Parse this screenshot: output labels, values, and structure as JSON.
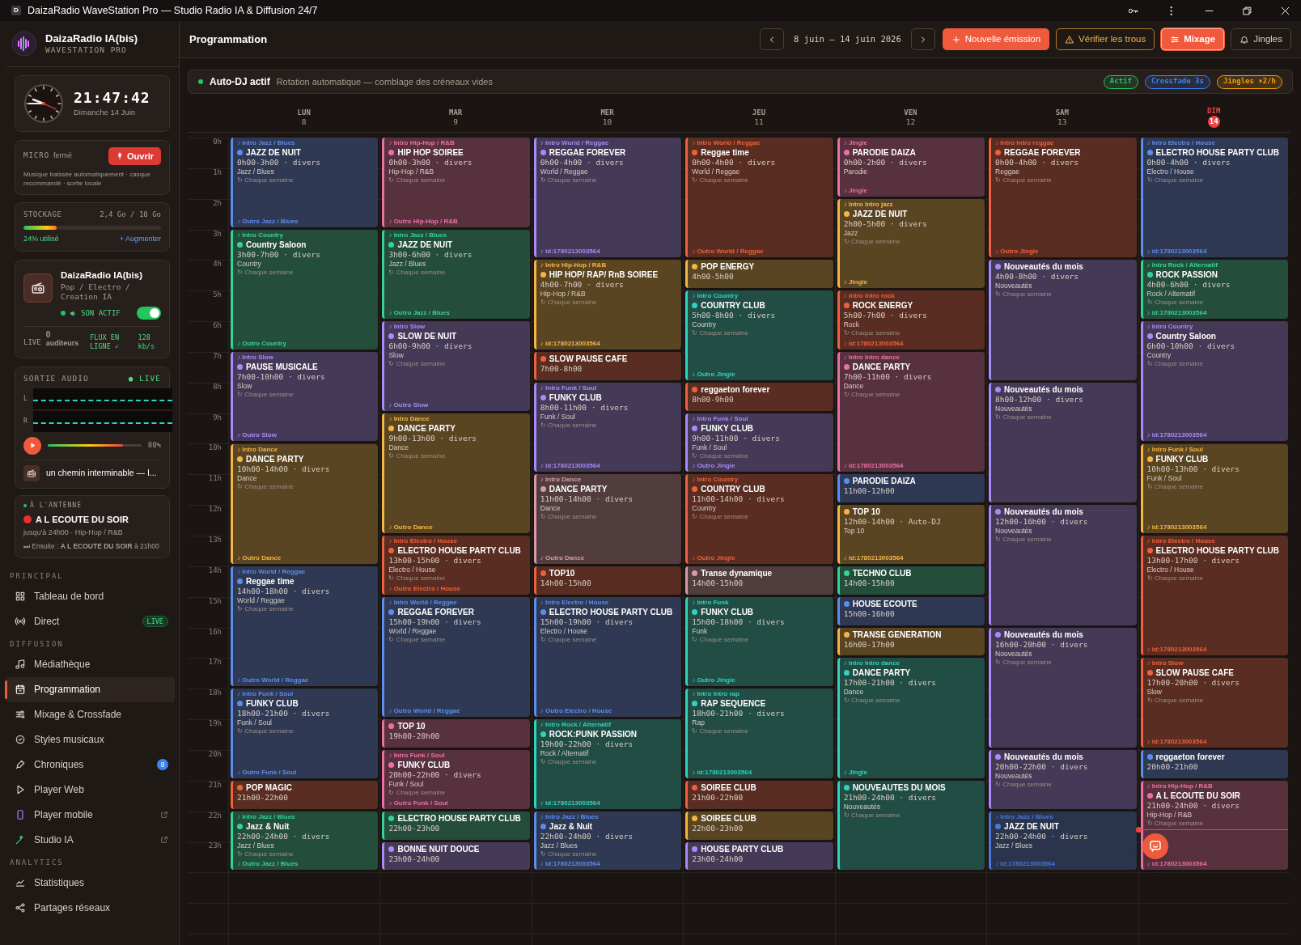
{
  "window": {
    "icon_letter": "D",
    "title": "DaizaRadio WaveStation Pro — Studio Radio IA & Diffusion 24/7"
  },
  "brand": {
    "name": "DaizaRadio IA(bis)",
    "subtitle": "WAVESTATION PRO"
  },
  "clock": {
    "time": "21:47:42",
    "date": "Dimanche 14 Juin"
  },
  "micro": {
    "label": "MICRO",
    "state": "fermé",
    "button": "Ouvrir",
    "note": "Musique baissée automatiquement · casque recommandé · sortie locale"
  },
  "storage": {
    "label": "STOCKAGE",
    "value": "2,4 Go / 10 Go",
    "level": 0.24,
    "used": "24% utilisé",
    "action": "+ Augmenter"
  },
  "station": {
    "name": "DaizaRadio IA(bis)",
    "genres": "Pop / Electro / Creation IA",
    "sound_label": "SON ACTIF",
    "on": true,
    "live": "LIVE",
    "listeners": "0",
    "listeners_label": "auditeurs",
    "stream": "FLUX EN LIGNE ✓",
    "bitrate": "128 kb/s"
  },
  "audio_out": {
    "title": "SORTIE AUDIO",
    "live": "● LIVE",
    "channels": [
      {
        "label": "L"
      },
      {
        "label": "R"
      }
    ],
    "volume": {
      "level": 0.8,
      "reading": "80%"
    },
    "track": "un chemin interminable — I..."
  },
  "on_air": {
    "label": "À L'ANTENNE",
    "title": "A L ECOUTE DU SOIR",
    "detail": "jusqu'à 24h00 · Hip-Hop / R&B",
    "next": "⏭ Ensuite : **A L ECOUTE DU SOIR** à 21h00"
  },
  "nav": [
    {
      "section": "PRINCIPAL",
      "items": [
        {
          "label": "Tableau de bord",
          "selected": false,
          "external": false
        },
        {
          "label": "Direct",
          "selected": false,
          "external": false,
          "badge": {
            "kind": "status",
            "text": "LIVE"
          }
        }
      ]
    },
    {
      "section": "DIFFUSION",
      "items": [
        {
          "label": "Médiathèque",
          "selected": false,
          "external": false
        },
        {
          "label": "Programmation",
          "selected": true,
          "external": false
        },
        {
          "label": "Mixage & Crossfade",
          "selected": false,
          "external": false
        },
        {
          "label": "Styles musicaux",
          "selected": false,
          "external": false
        },
        {
          "label": "Chroniques",
          "selected": false,
          "external": false,
          "badge": {
            "kind": "count",
            "text": "8"
          }
        },
        {
          "label": "Player Web",
          "selected": false,
          "external": false
        },
        {
          "label": "Player mobile",
          "selected": false,
          "external": true
        },
        {
          "label": "Studio IA",
          "selected": false,
          "external": true
        }
      ]
    },
    {
      "section": "ANALYTICS",
      "items": [
        {
          "label": "Statistiques",
          "selected": false,
          "external": false
        },
        {
          "label": "Partages réseaux",
          "selected": false,
          "external": false
        }
      ]
    }
  ],
  "header": {
    "title": "Programmation",
    "range": "8 juin — 14 juin 2026",
    "actions": [
      {
        "label": "Nouvelle émission",
        "kind": "primary"
      },
      {
        "label": "Vérifier les trous",
        "kind": "warning"
      },
      {
        "label": "Mixage",
        "kind": "toggle",
        "selected": true
      },
      {
        "label": "Jingles",
        "kind": "toggle",
        "selected": false
      }
    ]
  },
  "autodj": {
    "title": "Auto-DJ actif",
    "on": true,
    "description": "Rotation automatique — comblage des créneaux vides",
    "tags": [
      {
        "text": "Actif",
        "color": "#22c55e"
      },
      {
        "text": "Crossfade 3s",
        "color": "#3b82f6"
      },
      {
        "text": "Jingles ×2/h",
        "color": "#f59e0b"
      }
    ]
  },
  "calendar": {
    "hours": [
      "0h",
      "1h",
      "2h",
      "3h",
      "4h",
      "5h",
      "6h",
      "7h",
      "8h",
      "9h",
      "10h",
      "11h",
      "12h",
      "13h",
      "14h",
      "15h",
      "16h",
      "17h",
      "18h",
      "19h",
      "20h",
      "21h",
      "22h",
      "23h"
    ],
    "days": [
      {
        "name": "LUN",
        "date": "8",
        "today": false,
        "events": [
          {
            "color": "#5b8def",
            "intro": "♪ Intro Jazz / Blues",
            "title": "JAZZ DE NUIT",
            "time": "0h00-3h00 · divers",
            "style": "Jazz / Blues",
            "recur": "↻ Chaque semaine",
            "outro": "♪ Outro Jazz / Blues"
          },
          {
            "color": "#34d399",
            "intro": "♪ Intro Country",
            "title": "Country Saloon",
            "time": "3h00-7h00 · divers",
            "style": "Country",
            "recur": "↻ Chaque semaine",
            "outro": "♪ Outro Country"
          },
          {
            "color": "#a78bfa",
            "intro": "♪ Intro Slow",
            "title": "PAUSE MUSICALE",
            "time": "7h00-10h00 · divers",
            "style": "Slow",
            "recur": "↻ Chaque semaine",
            "outro": "♪ Outro Slow"
          },
          {
            "color": "#f5b544",
            "intro": "♪ Intro Dance",
            "title": "DANCE PARTY",
            "time": "10h00-14h00 · divers",
            "style": "Dance",
            "recur": "↻ Chaque semaine",
            "outro": "♪ Outro Dance"
          },
          {
            "color": "#5b8def",
            "intro": "♪ Intro World / Reggae",
            "title": "Reggae time",
            "time": "14h00-18h00 · divers",
            "style": "World / Reggae",
            "recur": "↻ Chaque semaine",
            "outro": "♪ Outro World / Reggae"
          },
          {
            "color": "#5b8def",
            "intro": "♪ Intro Funk / Soul",
            "title": "FUNKY CLUB",
            "time": "18h00-21h00 · divers",
            "style": "Funk / Soul",
            "recur": "↻ Chaque semaine",
            "outro": "♪ Outro Funk / Soul"
          },
          {
            "color": "#f0603c",
            "title": "POP MAGIC",
            "time": "21h00-22h00"
          },
          {
            "color": "#34d399",
            "intro": "♪ Intro Jazz / Blues",
            "title": "Jazz & Nuit",
            "time": "22h00-24h00 · divers",
            "style": "Jazz / Blues",
            "recur": "↻ Chaque semaine",
            "outro": "♪ Outro Jazz / Blues"
          }
        ]
      },
      {
        "name": "MAR",
        "date": "9",
        "today": false,
        "events": [
          {
            "color": "#ec6fa7",
            "intro": "♪ Intro Hip-Hop / R&B",
            "title": "HIP HOP SOIREE",
            "time": "0h00-3h00 · divers",
            "style": "Hip-Hop / R&B",
            "recur": "↻ Chaque semaine",
            "outro": "♪ Outro Hip-Hop / R&B"
          },
          {
            "color": "#34d399",
            "intro": "♪ Intro Jazz / Blues",
            "title": "JAZZ DE NUIT",
            "time": "3h00-6h00 · divers",
            "style": "Jazz / Blues",
            "recur": "↻ Chaque semaine",
            "outro": "♪ Outro Jazz / Blues"
          },
          {
            "color": "#a78bfa",
            "intro": "♪ Intro Slow",
            "title": "SLOW DE NUIT",
            "time": "6h00-9h00 · divers",
            "style": "Slow",
            "recur": "↻ Chaque semaine",
            "outro": "♪ Outro Slow"
          },
          {
            "color": "#f5b544",
            "intro": "♪ Intro Dance",
            "title": "DANCE PARTY",
            "time": "9h00-13h00 · divers",
            "style": "Dance",
            "recur": "↻ Chaque semaine",
            "outro": "♪ Outro Dance"
          },
          {
            "color": "#f0603c",
            "intro": "♪ Intro Electro / House",
            "title": "ELECTRO HOUSE PARTY CLUB",
            "time": "13h00-15h00 · divers",
            "style": "Electro / House",
            "recur": "↻ Chaque semaine",
            "outro": "♪ Outro Electro / House"
          },
          {
            "color": "#5b8def",
            "intro": "♪ Intro World / Reggae",
            "title": "REGGAE FOREVER",
            "time": "15h00-19h00 · divers",
            "style": "World / Reggae",
            "recur": "↻ Chaque semaine",
            "outro": "♪ Outro World / Reggae"
          },
          {
            "color": "#ec6fa7",
            "title": "TOP 10",
            "time": "19h00-20h00"
          },
          {
            "color": "#ec6fa7",
            "intro": "♪ Intro Funk / Soul",
            "title": "FUNKY CLUB",
            "time": "20h00-22h00 · divers",
            "style": "Funk / Soul",
            "recur": "↻ Chaque semaine",
            "outro": "♪ Outro Funk / Soul"
          },
          {
            "color": "#34d399",
            "title": "ELECTRO HOUSE PARTY CLUB",
            "time": "22h00-23h00"
          },
          {
            "color": "#a78bfa",
            "title": "BONNE NUIT DOUCE",
            "time": "23h00-24h00"
          }
        ]
      },
      {
        "name": "MER",
        "date": "10",
        "today": false,
        "events": [
          {
            "color": "#a78bfa",
            "intro": "♪ Intro World / Reggae",
            "title": "REGGAE FOREVER",
            "time": "0h00-4h00 · divers",
            "style": "World / Reggae",
            "recur": "↻ Chaque semaine",
            "outro": "♪ id:1780213003564"
          },
          {
            "color": "#f5b544",
            "intro": "♪ Intro Hip-Hop / R&B",
            "title": "HIP HOP/ RAP/ RnB SOIREE",
            "time": "4h00-7h00 · divers",
            "style": "Hip-Hop / R&B",
            "recur": "↻ Chaque semaine",
            "outro": "♪ id:1780213003564"
          },
          {
            "color": "#f0603c",
            "title": "SLOW PAUSE CAFE",
            "time": "7h00-8h00"
          },
          {
            "color": "#a78bfa",
            "intro": "♪ Intro Funk / Soul",
            "title": "FUNKY CLUB",
            "time": "8h00-11h00 · divers",
            "style": "Funk / Soul",
            "recur": "↻ Chaque semaine",
            "outro": "♪ id:1780213003564"
          },
          {
            "color": "#d99aa6",
            "intro": "♪ Intro Dance",
            "title": "DANCE PARTY",
            "time": "11h00-14h00 · divers",
            "style": "Dance",
            "recur": "↻ Chaque semaine",
            "outro": "♪ Outro Dance"
          },
          {
            "color": "#f0603c",
            "title": "TOP10",
            "time": "14h00-15h00"
          },
          {
            "color": "#5b8def",
            "intro": "♪ Intro Electro / House",
            "title": "ELECTRO HOUSE PARTY CLUB",
            "time": "15h00-19h00 · divers",
            "style": "Electro / House",
            "recur": "↻ Chaque semaine",
            "outro": "♪ Outro Electro / House"
          },
          {
            "color": "#2dd4bf",
            "intro": "♪ Intro Rock / Alternatif",
            "title": "ROCK:PUNK PASSION",
            "time": "19h00-22h00 · divers",
            "style": "Rock / Alternatif",
            "recur": "↻ Chaque semaine",
            "outro": "♪ id:1780213003564"
          },
          {
            "color": "#5b8def",
            "intro": "♪ Intro Jazz / Blues",
            "title": "Jazz & Nuit",
            "time": "22h00-24h00 · divers",
            "style": "Jazz / Blues",
            "recur": "↻ Chaque semaine",
            "outro": "♪ id:1780213003564"
          }
        ]
      },
      {
        "name": "JEU",
        "date": "11",
        "today": false,
        "events": [
          {
            "color": "#f0603c",
            "intro": "♪ Intro World / Reggae",
            "title": "Reggae time",
            "time": "0h00-4h00 · divers",
            "style": "World / Reggae",
            "recur": "↻ Chaque semaine",
            "outro": "♪ Outro World / Reggae"
          },
          {
            "color": "#f5b544",
            "title": "POP ENERGY",
            "time": "4h00-5h00"
          },
          {
            "color": "#2dd4bf",
            "intro": "♪ Intro Country",
            "title": "COUNTRY CLUB",
            "time": "5h00-8h00 · divers",
            "style": "Country",
            "recur": "↻ Chaque semaine",
            "outro": "♪ Outro Jingle"
          },
          {
            "color": "#f0603c",
            "title": "reggaeton forever",
            "time": "8h00-9h00"
          },
          {
            "color": "#a78bfa",
            "intro": "♪ Intro Funk / Soul",
            "title": "FUNKY CLUB",
            "time": "9h00-11h00 · divers",
            "style": "Funk / Soul",
            "recur": "↻ Chaque semaine",
            "outro": "♪ Outro Jingle"
          },
          {
            "color": "#f0603c",
            "intro": "♪ Intro Country",
            "title": "COUNTRY CLUB",
            "time": "11h00-14h00 · divers",
            "style": "Country",
            "recur": "↻ Chaque semaine",
            "outro": "♪ Outro Jingle"
          },
          {
            "color": "#d99aa6",
            "title": "Transe dynamique",
            "time": "14h00-15h00"
          },
          {
            "color": "#2dd4bf",
            "intro": "♪ Intro Funk",
            "title": "FUNKY CLUB",
            "time": "15h00-18h00 · divers",
            "style": "Funk",
            "recur": "↻ Chaque semaine",
            "outro": "♪ Outro Jingle"
          },
          {
            "color": "#2dd4bf",
            "intro": "♪ Intro Intro rap",
            "title": "RAP SEQUENCE",
            "time": "18h00-21h00 · divers",
            "style": "Rap",
            "recur": "↻ Chaque semaine",
            "outro": "♪ id:1780213003564"
          },
          {
            "color": "#f0603c",
            "title": "SOIREE CLUB",
            "time": "21h00-22h00"
          },
          {
            "color": "#f5b544",
            "title": "SOIREE CLUB",
            "time": "22h00-23h00"
          },
          {
            "color": "#a78bfa",
            "title": "HOUSE PARTY CLUB",
            "time": "23h00-24h00"
          }
        ]
      },
      {
        "name": "VEN",
        "date": "12",
        "today": false,
        "events": [
          {
            "color": "#ec6fa7",
            "intro": "♪ Jingle",
            "title": "PARODIE DAIZA",
            "time": "0h00-2h00 · divers",
            "style": "Parodie",
            "outro": "♪ Jingle"
          },
          {
            "color": "#f5b544",
            "intro": "♪ Intro Intro jazz",
            "title": "JAZZ DE NUIT",
            "time": "2h00-5h00 · divers",
            "style": "Jazz",
            "recur": "↻ Chaque semaine",
            "outro": "♪ Jingle"
          },
          {
            "color": "#f0603c",
            "intro": "♪ Intro Intro rock",
            "title": "ROCK ENERGY",
            "time": "5h00-7h00 · divers",
            "style": "Rock",
            "recur": "↻ Chaque semaine",
            "outro": "♪ id:1780213003564"
          },
          {
            "color": "#ec6fa7",
            "intro": "♪ Intro Intro dance",
            "title": "DANCE PARTY",
            "time": "7h00-11h00 · divers",
            "style": "Dance",
            "recur": "↻ Chaque semaine",
            "outro": "♪ id:1780213003564"
          },
          {
            "color": "#5b8def",
            "title": "PARODIE DAIZA",
            "time": "11h00-12h00"
          },
          {
            "color": "#f5b544",
            "title": "TOP 10",
            "time": "12h00-14h00 · Auto-DJ",
            "style": "Top 10",
            "outro": "♪ id:1780213003564"
          },
          {
            "color": "#34d399",
            "title": "TECHNO CLUB",
            "time": "14h00-15h00"
          },
          {
            "color": "#5b8def",
            "title": "HOUSE ECOUTE",
            "time": "15h00-16h00"
          },
          {
            "color": "#f5b544",
            "title": "TRANSE GENERATION",
            "time": "16h00-17h00"
          },
          {
            "color": "#2dd4bf",
            "intro": "♪ Intro Intro dance",
            "title": "DANCE PARTY",
            "time": "17h00-21h00 · divers",
            "style": "Dance",
            "recur": "↻ Chaque semaine",
            "outro": "♪ Jingle"
          },
          {
            "color": "#2dd4bf",
            "title": "NOUVEAUTES DU MOIS",
            "time": "21h00-24h00 · divers",
            "style": "Nouveautés",
            "recur": "↻ Chaque semaine"
          }
        ]
      },
      {
        "name": "SAM",
        "date": "13",
        "today": false,
        "events": [
          {
            "color": "#f0603c",
            "intro": "♪ Intro Intro reggae",
            "title": "REGGAE FOREVER",
            "time": "0h00-4h00 · divers",
            "style": "Reggae",
            "recur": "↻ Chaque semaine",
            "outro": "♪ Outro Jingle"
          },
          {
            "color": "#a78bfa",
            "title": "Nouveautés du mois",
            "time": "4h00-8h00 · divers",
            "style": "Nouveautés",
            "recur": "↻ Chaque semaine"
          },
          {
            "color": "#a78bfa",
            "title": "Nouveautés du mois",
            "time": "8h00-12h00 · divers",
            "style": "Nouveautés",
            "recur": "↻ Chaque semaine"
          },
          {
            "color": "#a78bfa",
            "title": "Nouveautés du mois",
            "time": "12h00-16h00 · divers",
            "style": "Nouveautés",
            "recur": "↻ Chaque semaine"
          },
          {
            "color": "#a78bfa",
            "title": "Nouveautés du mois",
            "time": "16h00-20h00 · divers",
            "style": "Nouveautés",
            "recur": "↻ Chaque semaine"
          },
          {
            "color": "#a78bfa",
            "title": "Nouveautés du mois",
            "time": "20h00-22h00 · divers",
            "style": "Nouveautés",
            "recur": "↻ Chaque semaine"
          },
          {
            "color": "#4a78d8",
            "intro": "♪ Intro Jazz / Blues",
            "title": "JAZZ DE NUIT",
            "time": "22h00-24h00 · divers",
            "style": "Jazz / Blues",
            "outro": "♪ id:1780213003564"
          }
        ]
      },
      {
        "name": "DIM",
        "date": "14",
        "today": true,
        "events": [
          {
            "color": "#5b8def",
            "intro": "♪ Intro Electro / House",
            "title": "ELECTRO HOUSE PARTY CLUB",
            "time": "0h00-4h00 · divers",
            "style": "Electro / House",
            "recur": "↻ Chaque semaine",
            "outro": "♪ id:1780213003564"
          },
          {
            "color": "#34d399",
            "intro": "♪ Intro Rock / Alternatif",
            "title": "ROCK PASSION",
            "time": "4h00-6h00 · divers",
            "style": "Rock / Alternatif",
            "recur": "↻ Chaque semaine",
            "outro": "♪ id:1780213003564"
          },
          {
            "color": "#a78bfa",
            "intro": "♪ Intro Country",
            "title": "Country Saloon",
            "time": "6h00-10h00 · divers",
            "style": "Country",
            "recur": "↻ Chaque semaine",
            "outro": "♪ id:1780213003564"
          },
          {
            "color": "#f5b544",
            "intro": "♪ Intro Funk / Soul",
            "title": "FUNKY CLUB",
            "time": "10h00-13h00 · divers",
            "style": "Funk / Soul",
            "recur": "↻ Chaque semaine",
            "outro": "♪ id:1780213003564"
          },
          {
            "color": "#f0603c",
            "intro": "♪ Intro Electro / House",
            "title": "ELECTRO HOUSE PARTY CLUB",
            "time": "13h00-17h00 · divers",
            "style": "Electro / House",
            "recur": "↻ Chaque semaine",
            "outro": "♪ id:1780213003564"
          },
          {
            "color": "#f0603c",
            "intro": "♪ Intro Slow",
            "title": "SLOW PAUSE CAFE",
            "time": "17h00-20h00 · divers",
            "style": "Slow",
            "recur": "↻ Chaque semaine",
            "outro": "♪ id:1780213003564"
          },
          {
            "color": "#5b8def",
            "title": "reggaeton forever",
            "time": "20h00-21h00"
          },
          {
            "color": "#ec6fa7",
            "intro": "♪ Intro Hip-Hop / R&B",
            "title": "A L ECOUTE DU SOIR",
            "time": "21h00-24h00 · divers",
            "style": "Hip-Hop / R&B",
            "recur": "↻ Chaque semaine",
            "outro": "♪ id:1780213003564"
          }
        ]
      }
    ]
  }
}
